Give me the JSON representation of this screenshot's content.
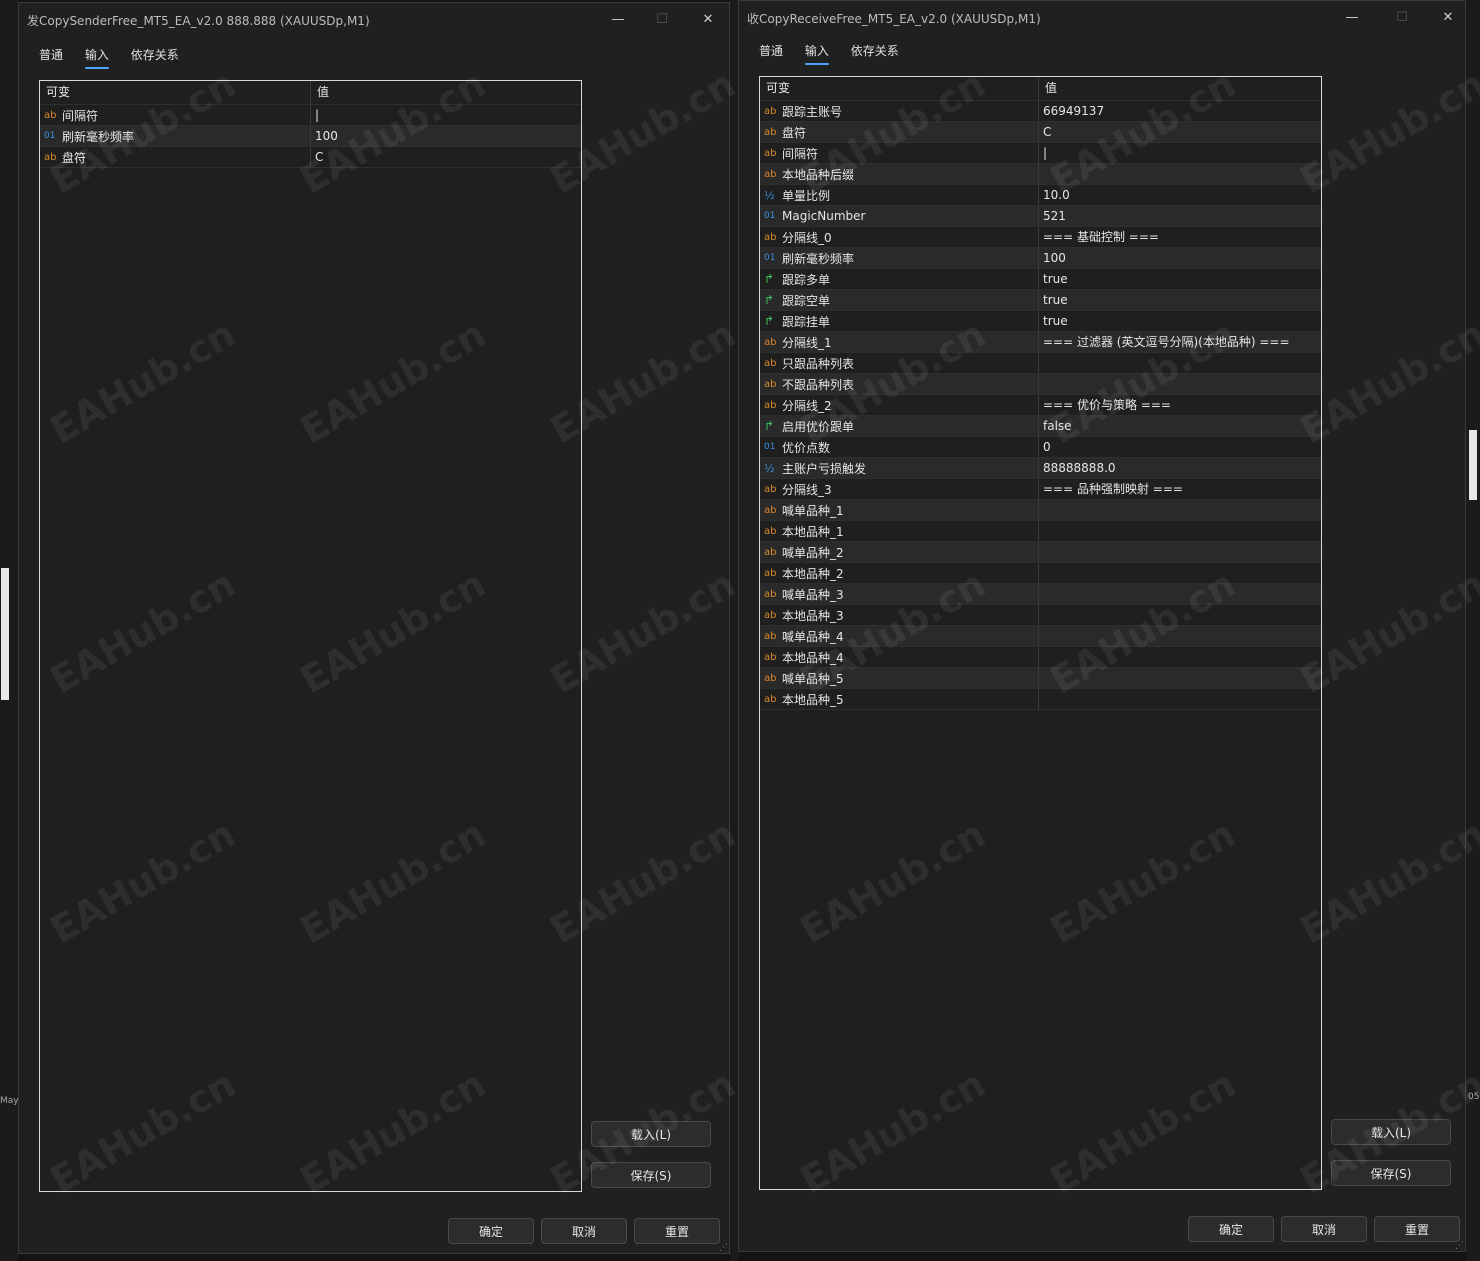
{
  "sender": {
    "title": "发CopySenderFree_MT5_EA_v2.0 888.888 (XAUUSDp,M1)",
    "tabs": [
      "普通",
      "输入",
      "依存关系"
    ],
    "active_tab": 1,
    "headers": {
      "name": "可变",
      "value": "值"
    },
    "rows": [
      {
        "icon": "ab",
        "icon_name": "string-type-icon",
        "name": "间隔符",
        "value": "|"
      },
      {
        "icon": "01",
        "icon_name": "integer-type-icon",
        "name": "刷新毫秒频率",
        "value": "100"
      },
      {
        "icon": "ab",
        "icon_name": "string-type-icon",
        "name": "盘符",
        "value": "C"
      }
    ],
    "load_label": "载入(L)",
    "save_label": "保存(S)",
    "ok_label": "确定",
    "cancel_label": "取消",
    "reset_label": "重置"
  },
  "receiver": {
    "title": "收CopyReceiveFree_MT5_EA_v2.0 (XAUUSDp,M1)",
    "tabs": [
      "普通",
      "输入",
      "依存关系"
    ],
    "active_tab": 1,
    "headers": {
      "name": "可变",
      "value": "值"
    },
    "rows": [
      {
        "icon": "ab",
        "icon_name": "string-type-icon",
        "name": "跟踪主账号",
        "value": "66949137"
      },
      {
        "icon": "ab",
        "icon_name": "string-type-icon",
        "name": "盘符",
        "value": "C"
      },
      {
        "icon": "ab",
        "icon_name": "string-type-icon",
        "name": "间隔符",
        "value": "|"
      },
      {
        "icon": "ab",
        "icon_name": "string-type-icon",
        "name": "本地品种后缀",
        "value": ""
      },
      {
        "icon": "½",
        "icon_name": "double-type-icon",
        "name": "单量比例",
        "value": "10.0"
      },
      {
        "icon": "01",
        "icon_name": "integer-type-icon",
        "name": "MagicNumber",
        "value": "521"
      },
      {
        "icon": "ab",
        "icon_name": "string-type-icon",
        "name": "分隔线_0",
        "value": "=== 基础控制 ==="
      },
      {
        "icon": "01",
        "icon_name": "integer-type-icon",
        "name": "刷新毫秒频率",
        "value": "100"
      },
      {
        "icon": "↱",
        "icon_name": "bool-type-icon",
        "name": "跟踪多单",
        "value": "true"
      },
      {
        "icon": "↱",
        "icon_name": "bool-type-icon",
        "name": "跟踪空单",
        "value": "true"
      },
      {
        "icon": "↱",
        "icon_name": "bool-type-icon",
        "name": "跟踪挂单",
        "value": "true"
      },
      {
        "icon": "ab",
        "icon_name": "string-type-icon",
        "name": "分隔线_1",
        "value": "=== 过滤器 (英文逗号分隔)(本地品种) ==="
      },
      {
        "icon": "ab",
        "icon_name": "string-type-icon",
        "name": "只跟品种列表",
        "value": ""
      },
      {
        "icon": "ab",
        "icon_name": "string-type-icon",
        "name": "不跟品种列表",
        "value": ""
      },
      {
        "icon": "ab",
        "icon_name": "string-type-icon",
        "name": "分隔线_2",
        "value": "=== 优价与策略 ==="
      },
      {
        "icon": "↱",
        "icon_name": "bool-type-icon",
        "name": "启用优价跟单",
        "value": "false"
      },
      {
        "icon": "01",
        "icon_name": "integer-type-icon",
        "name": "优价点数",
        "value": "0"
      },
      {
        "icon": "½",
        "icon_name": "double-type-icon",
        "name": "主账户亏损触发",
        "value": "88888888.0"
      },
      {
        "icon": "ab",
        "icon_name": "string-type-icon",
        "name": "分隔线_3",
        "value": "=== 品种强制映射 ==="
      },
      {
        "icon": "ab",
        "icon_name": "string-type-icon",
        "name": "喊单品种_1",
        "value": ""
      },
      {
        "icon": "ab",
        "icon_name": "string-type-icon",
        "name": "本地品种_1",
        "value": ""
      },
      {
        "icon": "ab",
        "icon_name": "string-type-icon",
        "name": "喊单品种_2",
        "value": ""
      },
      {
        "icon": "ab",
        "icon_name": "string-type-icon",
        "name": "本地品种_2",
        "value": ""
      },
      {
        "icon": "ab",
        "icon_name": "string-type-icon",
        "name": "喊单品种_3",
        "value": ""
      },
      {
        "icon": "ab",
        "icon_name": "string-type-icon",
        "name": "本地品种_3",
        "value": ""
      },
      {
        "icon": "ab",
        "icon_name": "string-type-icon",
        "name": "喊单品种_4",
        "value": ""
      },
      {
        "icon": "ab",
        "icon_name": "string-type-icon",
        "name": "本地品种_4",
        "value": ""
      },
      {
        "icon": "ab",
        "icon_name": "string-type-icon",
        "name": "喊单品种_5",
        "value": ""
      },
      {
        "icon": "ab",
        "icon_name": "string-type-icon",
        "name": "本地品种_5",
        "value": ""
      }
    ],
    "load_label": "载入(L)",
    "save_label": "保存(S)",
    "ok_label": "确定",
    "cancel_label": "取消",
    "reset_label": "重置"
  },
  "window_controls": {
    "minimize": "—",
    "maximize": "☐",
    "close": "✕"
  },
  "watermark": "EAHub.cn",
  "background": {
    "left_edge_text": "May",
    "right_edge_text": "05"
  },
  "colors": {
    "window_bg": "#202020",
    "accent": "#4aa3ff",
    "string_icon": "#d98a2b",
    "number_icon": "#3b8fe0",
    "bool_icon": "#3cc45a"
  }
}
